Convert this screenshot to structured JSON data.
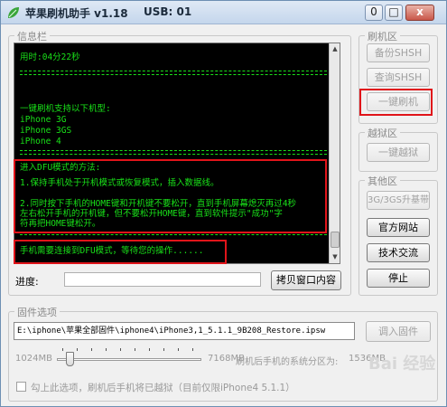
{
  "window": {
    "title": "苹果刷机助手 v1.18",
    "usb": "USB: 01",
    "minimize_label": "0",
    "maximize_label": "□",
    "close_label": "x"
  },
  "info": {
    "group_label": "信息栏",
    "console": {
      "time_line": "用时:04分22秒",
      "rule_1": "=========================================================",
      "heading": "一键刷机支持以下机型:",
      "models": [
        "iPhone 3G",
        "iPhone 3GS",
        "iPhone 4"
      ],
      "rule_2": "=========================================================",
      "dfu_title": "进入DFU模式的方法:",
      "dfu_step1": "1.保持手机处于开机模式或恢复模式，插入数据线。",
      "dfu_step2_l1": "2.同时按下手机的HOME键和开机键不要松开，直到手机屏幕熄灭再过4秒",
      "dfu_step2_l2": "左右松开手机的开机键，但不要松开HOME键，直到软件提示\"成功\"字",
      "dfu_step2_l3": "符再把HOME键松开。",
      "rule_3": "=========================================================",
      "waiting": "手机需要连接到DFU模式，等待您的操作......"
    },
    "progress_label": "进度:",
    "progress": 0,
    "copy_button": "拷贝窗口内容"
  },
  "flash_group": {
    "label": "刷机区",
    "backup_shsh": "备份SHSH",
    "query_shsh": "查询SHSH",
    "one_click_flash": "一键刷机"
  },
  "jailbreak_group": {
    "label": "越狱区",
    "one_click_jailbreak": "一键越狱"
  },
  "other_group": {
    "label": "其他区",
    "baseband": "3G/3GS升基带",
    "official_site": "官方网站",
    "tech_exchange": "技术交流",
    "stop": "停止"
  },
  "firmware": {
    "group_label": "固件选项",
    "path": "E:\\iphone\\苹果全部固件\\iphone4\\iPhone3,1_5.1.1_9B208_Restore.ipsw",
    "import_button": "调入固件",
    "min_size": "1024MB",
    "max_size": "7168MB",
    "partition_label": "刷机后手机的系统分区为:",
    "partition_value": "1536MB",
    "jailbreak_checkbox": "勾上此选项，刷机后手机将已越狱（目前仅限iPhone4 5.1.1）"
  },
  "watermark": "Bai 经验",
  "colors": {
    "console_bg": "#000000",
    "console_text": "#19e219",
    "highlight": "#e0141a"
  }
}
